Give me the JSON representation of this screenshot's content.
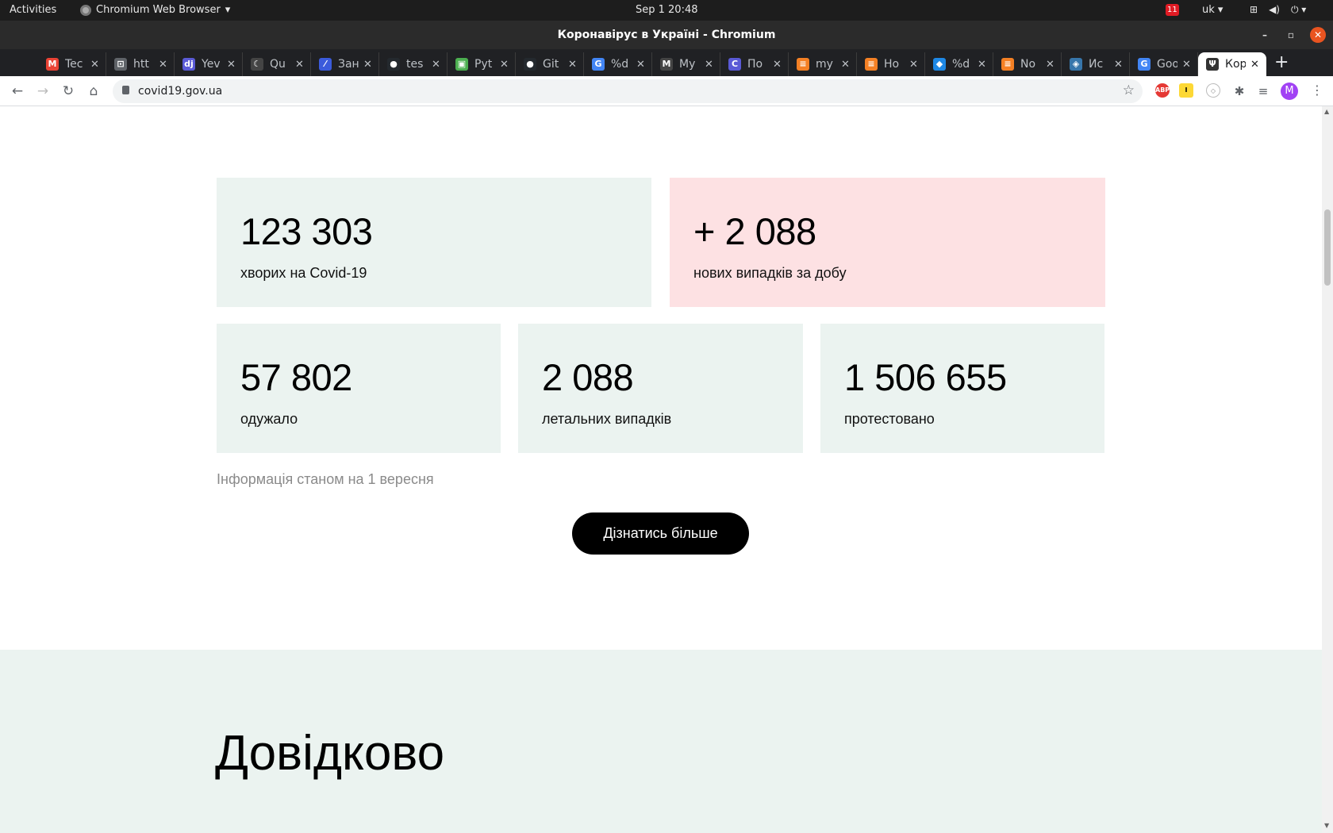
{
  "system_bar": {
    "activities": "Activities",
    "app_name": "Chromium Web Browser",
    "clock": "Sep 1  20:48",
    "notification_count": "11",
    "language": "uk"
  },
  "window": {
    "title": "Коронавірус в Україні - Chromium"
  },
  "tabs": [
    {
      "label": "Tec",
      "icon": "gmail-icon",
      "color": "#ea4335",
      "glyph": "M"
    },
    {
      "label": "htt",
      "icon": "page-icon",
      "color": "#5f6368",
      "glyph": "⊡"
    },
    {
      "label": "Yev",
      "icon": "django-icon",
      "color": "#5b5bd6",
      "glyph": "dj"
    },
    {
      "label": "Qu",
      "icon": "phone-icon",
      "color": "#444",
      "glyph": "☾"
    },
    {
      "label": "Зан",
      "icon": "feather-icon",
      "color": "#3b5bdb",
      "glyph": "⁄"
    },
    {
      "label": "tes",
      "icon": "github-icon",
      "color": "#24292e",
      "glyph": "●"
    },
    {
      "label": "Pyt",
      "icon": "chart-icon",
      "color": "#4caf50",
      "glyph": "▣"
    },
    {
      "label": "Git",
      "icon": "github-icon",
      "color": "#24292e",
      "glyph": "●"
    },
    {
      "label": "%d",
      "icon": "google-icon",
      "color": "#4285f4",
      "glyph": "G"
    },
    {
      "label": "My",
      "icon": "mail-icon",
      "color": "#444",
      "glyph": "M"
    },
    {
      "label": "По",
      "icon": "copy-icon",
      "color": "#5a5ad6",
      "glyph": "C"
    },
    {
      "label": "my",
      "icon": "stackoverflow-icon",
      "color": "#f48024",
      "glyph": "≡"
    },
    {
      "label": "Ho",
      "icon": "stackoverflow-icon",
      "color": "#f48024",
      "glyph": "≡"
    },
    {
      "label": "%d",
      "icon": "drop-icon",
      "color": "#1e88e5",
      "glyph": "◆"
    },
    {
      "label": "No",
      "icon": "stackoverflow-icon",
      "color": "#f48024",
      "glyph": "≡"
    },
    {
      "label": "Ис",
      "icon": "python-icon",
      "color": "#3776ab",
      "glyph": "◈"
    },
    {
      "label": "Goo",
      "icon": "translate-icon",
      "color": "#4285f4",
      "glyph": "G"
    },
    {
      "label": "Кор",
      "icon": "trident-icon",
      "color": "#333",
      "glyph": "Ψ",
      "active": true
    }
  ],
  "omnibox": {
    "url": "covid19.gov.ua"
  },
  "profile_initial": "M",
  "stats": {
    "total_cases": {
      "value": "123 303",
      "label": "хворих на Covid-19"
    },
    "new_cases": {
      "value": "+ 2 088",
      "label": "нових випадків за добу"
    },
    "recovered": {
      "value": "57 802",
      "label": "одужало"
    },
    "deaths": {
      "value": "2 088",
      "label": "летальних випадків"
    },
    "tested": {
      "value": "1 506 655",
      "label": "протестовано"
    }
  },
  "info_note": "Інформація станом на 1 вересня",
  "more_button": "Дізнатись більше",
  "reference_heading": "Довідково",
  "colors": {
    "card_green": "#ebf3f0",
    "card_pink": "#fde1e3",
    "button_black": "#000000"
  }
}
